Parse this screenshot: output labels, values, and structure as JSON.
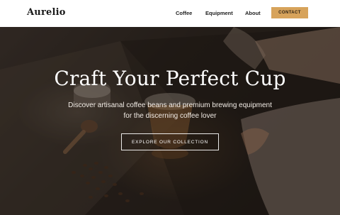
{
  "brand": {
    "name": "Aurelio"
  },
  "nav": {
    "items": [
      {
        "label": "Coffee"
      },
      {
        "label": "Equipment"
      },
      {
        "label": "About"
      }
    ],
    "contact_label": "CONTACT"
  },
  "hero": {
    "title": "Craft Your Perfect Cup",
    "subtitle": "Discover artisanal coffee beans and premium brewing equipment for the discerning coffee lover",
    "cta_label": "EXPLORE OUR COLLECTION"
  },
  "colors": {
    "accent": "#d7a35b",
    "hero_dark": "#2c2521",
    "text_light": "#ffffff"
  }
}
